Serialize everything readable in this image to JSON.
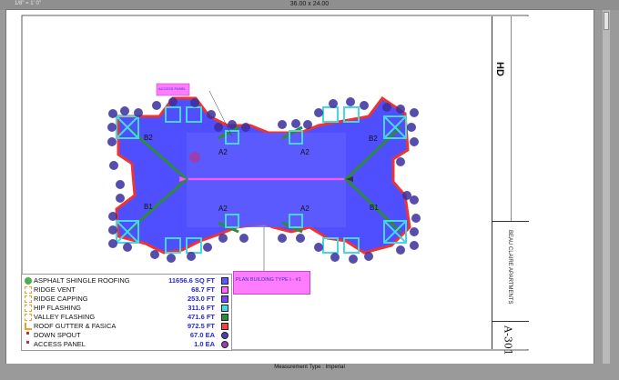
{
  "viewer": {
    "scale_label": "1/8\" = 1' 0\"",
    "sheet_size": "36.00 x 24.00",
    "measurement_type": "Measurement Type : Imperial"
  },
  "plan": {
    "unit_labels": [
      "A2",
      "A2",
      "A2",
      "A2",
      "B2",
      "B2",
      "B1",
      "B1"
    ],
    "tag_text": "PLAN BUILDING TYPE I - #1",
    "small_tag_text": "ACCESS PANEL"
  },
  "legend": {
    "items": [
      {
        "name": "ASPHALT SHINGLE ROOFING",
        "value": "11656.6 SQ FT",
        "color": "#5a5aff",
        "shape": "square",
        "icon": "shingle-icon"
      },
      {
        "name": "RIDGE VENT",
        "value": "68.7 FT",
        "color": "#ff66ff",
        "shape": "square",
        "icon": "ridge-vent-icon"
      },
      {
        "name": "RIDGE CAPPING",
        "value": "253.0 FT",
        "color": "#6a4df0",
        "shape": "square",
        "icon": "ridge-cap-icon"
      },
      {
        "name": "HIP FLASHING",
        "value": "311.6 FT",
        "color": "#45d7e6",
        "shape": "square",
        "icon": "hip-flashing-icon"
      },
      {
        "name": "VALLEY FLASHING",
        "value": "471.6 FT",
        "color": "#2e8b3a",
        "shape": "square",
        "icon": "valley-flashing-icon"
      },
      {
        "name": "ROOF GUTTER & FASICA",
        "value": "972.5 FT",
        "color": "#ee4444",
        "shape": "square",
        "icon": "gutter-icon"
      },
      {
        "name": "DOWN SPOUT",
        "value": "67.0 EA",
        "color": "#4a3fb0",
        "shape": "circle",
        "icon": "down-spout-icon"
      },
      {
        "name": "ACCESS PANEL",
        "value": "1.0 EA",
        "color": "#9b3fb0",
        "shape": "circle",
        "icon": "access-panel-icon"
      }
    ]
  },
  "titleblock": {
    "logo": "HD",
    "project": "BEAU CLAIRE APARTMENTS",
    "sheet_no": "A-301"
  }
}
